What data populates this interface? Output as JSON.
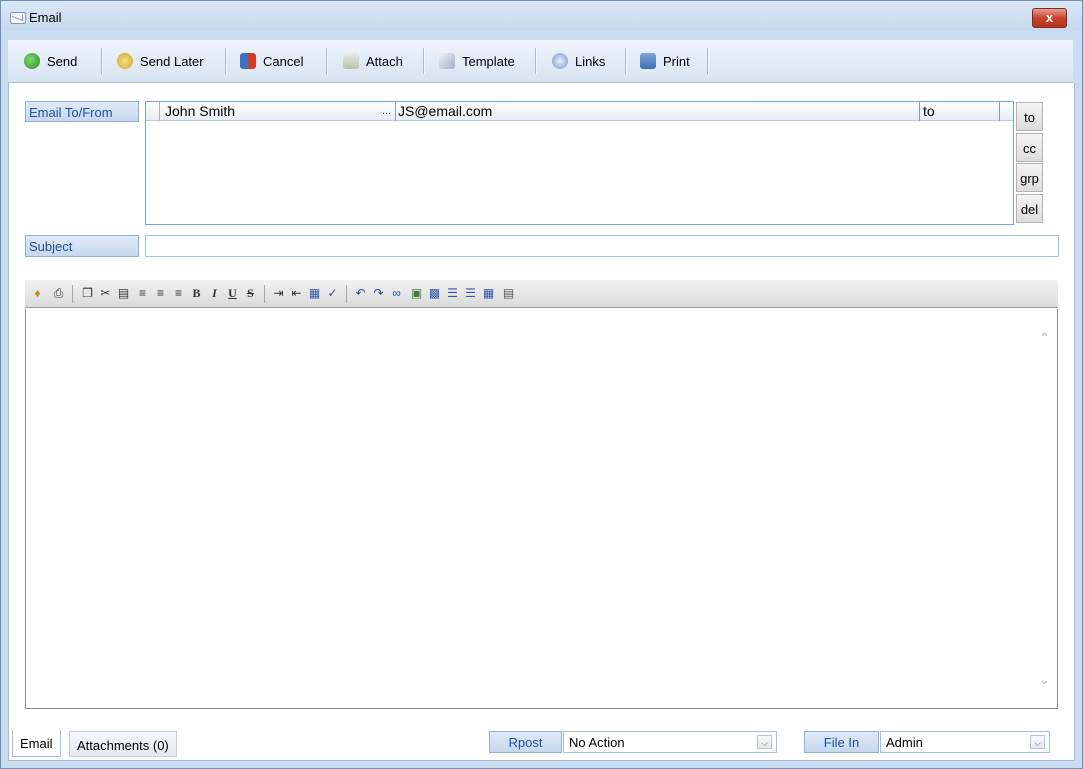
{
  "window": {
    "title": "Email",
    "close": "x"
  },
  "toolbar": {
    "send": "Send",
    "send_later": "Send Later",
    "cancel": "Cancel",
    "attach": "Attach",
    "template": "Template",
    "links": "Links",
    "print": "Print"
  },
  "recipients": {
    "label": "Email To/From",
    "rows": [
      {
        "name": "John Smith",
        "ellipsis": "...",
        "email": "JS@email.com",
        "type": "to"
      }
    ],
    "buttons": {
      "to": "to",
      "cc": "cc",
      "grp": "grp",
      "del": "del"
    }
  },
  "subject": {
    "label": "Subject",
    "value": ""
  },
  "bottom": {
    "tabs": {
      "email": "Email",
      "attachments": "Attachments (0)"
    },
    "rpost_label": "Rpost",
    "rpost_value": "No Action",
    "filein_label": "File In",
    "filein_value": "Admin"
  },
  "colors": {
    "accent": "#1f4f9a",
    "window_frame": "#c9dcf0",
    "close": "#c7452c"
  },
  "icons": [
    "envelope-icon",
    "send-icon",
    "clock-icon",
    "cancel-icon",
    "attach-icon",
    "template-icon",
    "links-icon",
    "print-icon"
  ]
}
